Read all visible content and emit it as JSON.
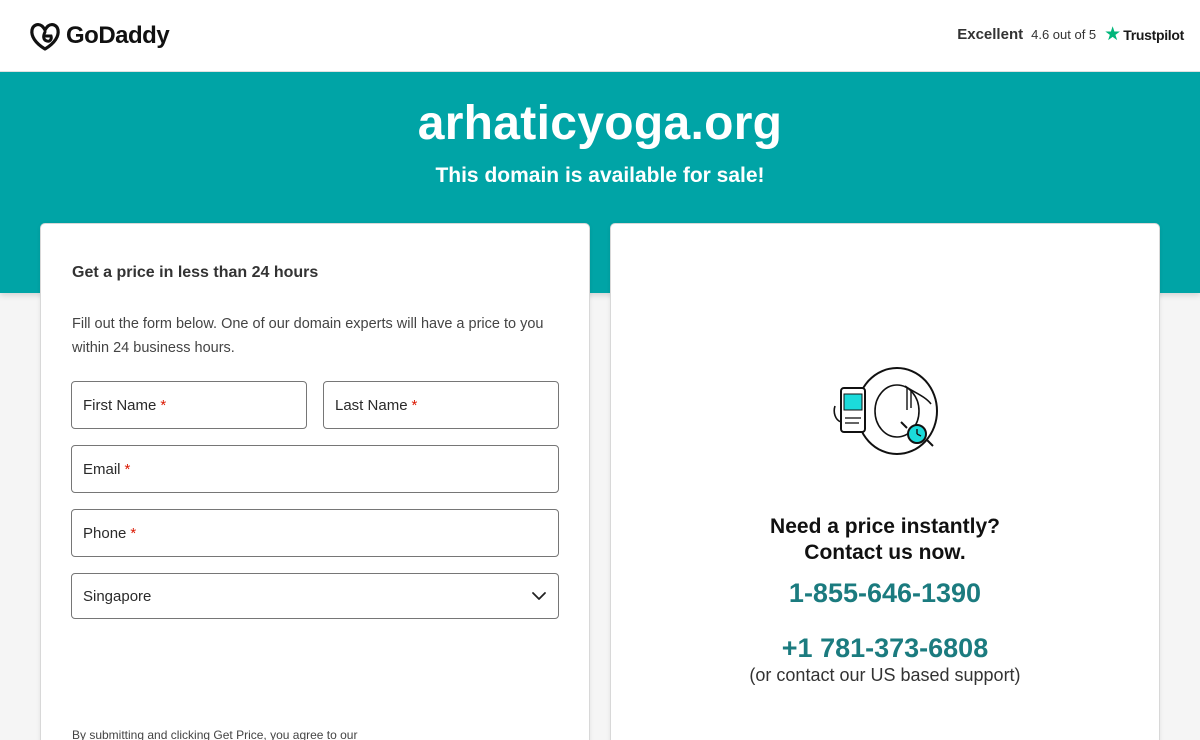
{
  "header": {
    "logo_text": "GoDaddy",
    "trustpilot": {
      "rating_word": "Excellent",
      "score_text": "4.6 out of 5",
      "star": "★",
      "brand": "Trustpilot"
    }
  },
  "hero": {
    "domain": "arhaticyoga.org",
    "subtitle": "This domain is available for sale!"
  },
  "form": {
    "heading": "Get a price in less than 24 hours",
    "description": "Fill out the form below. One of our domain experts will have a price to you within 24 business hours.",
    "required_marker": "*",
    "fields": {
      "first_name": "First Name",
      "last_name": "Last Name",
      "email": "Email",
      "phone": "Phone"
    },
    "country": {
      "selected": "Singapore"
    },
    "legal_text": "By submitting and clicking Get Price, you agree to our"
  },
  "contact": {
    "title_line1": "Need a price instantly?",
    "title_line2": "Contact us now.",
    "phone_primary": "1-855-646-1390",
    "phone_secondary": "+1 781-373-6808",
    "support_note": "(or contact our US based support)"
  },
  "colors": {
    "brand_teal": "#00a4a6",
    "phone_teal": "#1b7b7f",
    "required_red": "#db1802",
    "trustpilot_green": "#00b67a"
  },
  "icons": {
    "logo": "godaddy-logo-icon",
    "star": "trustpilot-star-icon",
    "dropdown": "chevron-down-icon",
    "illustration": "phone-hand-clock-illustration"
  }
}
